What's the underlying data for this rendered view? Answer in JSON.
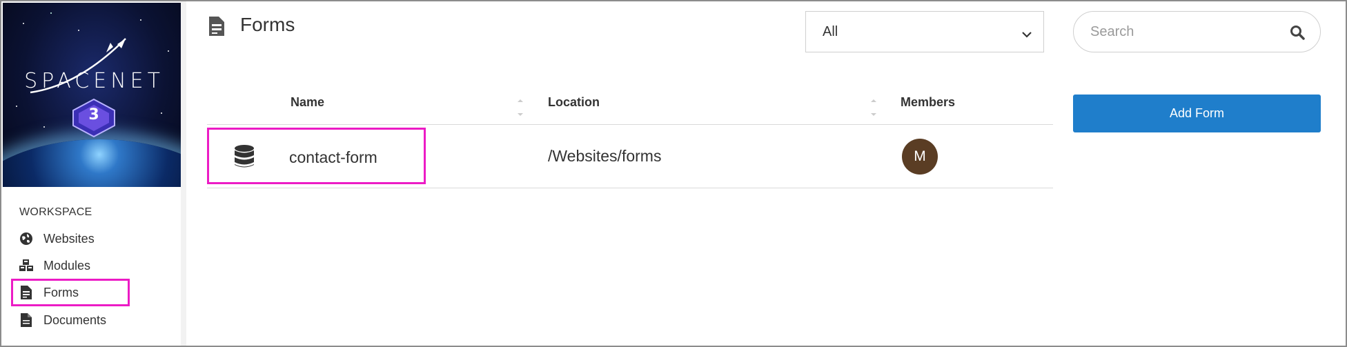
{
  "sidebar": {
    "brand": "SPACENET",
    "brand_badge": "3",
    "section_label": "WORKSPACE",
    "items": [
      {
        "label": "Websites",
        "icon": "globe-icon"
      },
      {
        "label": "Modules",
        "icon": "cubes-icon"
      },
      {
        "label": "Forms",
        "icon": "form-icon",
        "active": true
      },
      {
        "label": "Documents",
        "icon": "document-icon"
      }
    ]
  },
  "header": {
    "title": "Forms",
    "icon": "form-icon"
  },
  "filter": {
    "selected": "All"
  },
  "search": {
    "placeholder": "Search",
    "value": ""
  },
  "actions": {
    "add_label": "Add Form"
  },
  "table": {
    "columns": [
      "Name",
      "Location",
      "Members"
    ],
    "rows": [
      {
        "icon": "database-icon",
        "name": "contact-form",
        "location": "/Websites/forms",
        "member_initial": "M"
      }
    ]
  },
  "colors": {
    "accent": "#1f7ecb",
    "highlight": "#ec1bc5",
    "avatar": "#5a3d24"
  }
}
